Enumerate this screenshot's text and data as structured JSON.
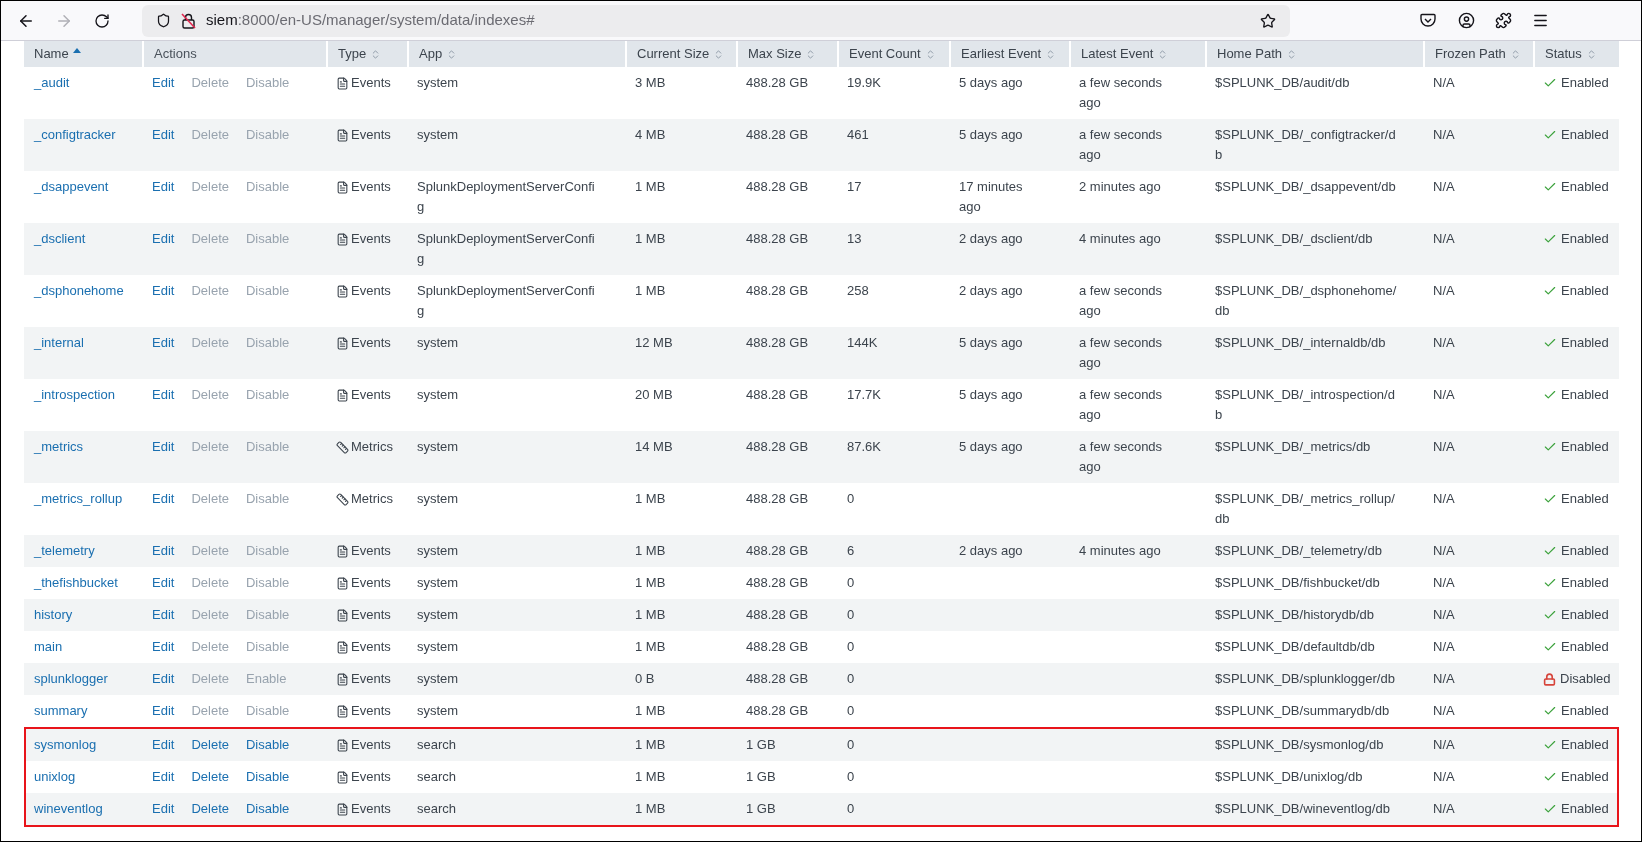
{
  "browser": {
    "url_host": "siem",
    "url_path": ":8000/en-US/manager/system/data/indexes#"
  },
  "table": {
    "columns": [
      {
        "label": "Name",
        "sortable": true,
        "selected": true
      },
      {
        "label": "Actions",
        "sortable": false,
        "selected": false
      },
      {
        "label": "Type",
        "sortable": true,
        "selected": false
      },
      {
        "label": "App",
        "sortable": true,
        "selected": false
      },
      {
        "label": "Current Size",
        "sortable": true,
        "selected": false
      },
      {
        "label": "Max Size",
        "sortable": true,
        "selected": false
      },
      {
        "label": "Event Count",
        "sortable": true,
        "selected": false
      },
      {
        "label": "Earliest Event",
        "sortable": true,
        "selected": false
      },
      {
        "label": "Latest Event",
        "sortable": true,
        "selected": false
      },
      {
        "label": "Home Path",
        "sortable": true,
        "selected": false
      },
      {
        "label": "Frozen Path",
        "sortable": true,
        "selected": false
      },
      {
        "label": "Status",
        "sortable": true,
        "selected": false
      }
    ],
    "rows": [
      {
        "name": "_audit",
        "actions": [
          {
            "label": "Edit",
            "disabled": false
          },
          {
            "label": "Delete",
            "disabled": true
          },
          {
            "label": "Disable",
            "disabled": true
          }
        ],
        "type": {
          "kind": "events",
          "label": "Events"
        },
        "app": "system",
        "current_size": "3 MB",
        "max_size": "488.28 GB",
        "event_count": "19.9K",
        "earliest_event": "5 days ago",
        "latest_event": "a few seconds ago",
        "home_path": "$SPLUNK_DB/audit/db",
        "frozen_path": "N/A",
        "status": {
          "kind": "enabled",
          "label": "Enabled"
        },
        "highlighted": false
      },
      {
        "name": "_configtracker",
        "actions": [
          {
            "label": "Edit",
            "disabled": false
          },
          {
            "label": "Delete",
            "disabled": true
          },
          {
            "label": "Disable",
            "disabled": true
          }
        ],
        "type": {
          "kind": "events",
          "label": "Events"
        },
        "app": "system",
        "current_size": "4 MB",
        "max_size": "488.28 GB",
        "event_count": "461",
        "earliest_event": "5 days ago",
        "latest_event": "a few seconds ago",
        "home_path": "$SPLUNK_DB/_configtracker/db",
        "frozen_path": "N/A",
        "status": {
          "kind": "enabled",
          "label": "Enabled"
        },
        "highlighted": false
      },
      {
        "name": "_dsappevent",
        "actions": [
          {
            "label": "Edit",
            "disabled": false
          },
          {
            "label": "Delete",
            "disabled": true
          },
          {
            "label": "Disable",
            "disabled": true
          }
        ],
        "type": {
          "kind": "events",
          "label": "Events"
        },
        "app": "SplunkDeploymentServerConfig",
        "current_size": "1 MB",
        "max_size": "488.28 GB",
        "event_count": "17",
        "earliest_event": "17 minutes ago",
        "latest_event": "2 minutes ago",
        "home_path": "$SPLUNK_DB/_dsappevent/db",
        "frozen_path": "N/A",
        "status": {
          "kind": "enabled",
          "label": "Enabled"
        },
        "highlighted": false
      },
      {
        "name": "_dsclient",
        "actions": [
          {
            "label": "Edit",
            "disabled": false
          },
          {
            "label": "Delete",
            "disabled": true
          },
          {
            "label": "Disable",
            "disabled": true
          }
        ],
        "type": {
          "kind": "events",
          "label": "Events"
        },
        "app": "SplunkDeploymentServerConfig",
        "current_size": "1 MB",
        "max_size": "488.28 GB",
        "event_count": "13",
        "earliest_event": "2 days ago",
        "latest_event": "4 minutes ago",
        "home_path": "$SPLUNK_DB/_dsclient/db",
        "frozen_path": "N/A",
        "status": {
          "kind": "enabled",
          "label": "Enabled"
        },
        "highlighted": false
      },
      {
        "name": "_dsphonehome",
        "actions": [
          {
            "label": "Edit",
            "disabled": false
          },
          {
            "label": "Delete",
            "disabled": true
          },
          {
            "label": "Disable",
            "disabled": true
          }
        ],
        "type": {
          "kind": "events",
          "label": "Events"
        },
        "app": "SplunkDeploymentServerConfig",
        "current_size": "1 MB",
        "max_size": "488.28 GB",
        "event_count": "258",
        "earliest_event": "2 days ago",
        "latest_event": "a few seconds ago",
        "home_path": "$SPLUNK_DB/_dsphonehome/db",
        "frozen_path": "N/A",
        "status": {
          "kind": "enabled",
          "label": "Enabled"
        },
        "highlighted": false
      },
      {
        "name": "_internal",
        "actions": [
          {
            "label": "Edit",
            "disabled": false
          },
          {
            "label": "Delete",
            "disabled": true
          },
          {
            "label": "Disable",
            "disabled": true
          }
        ],
        "type": {
          "kind": "events",
          "label": "Events"
        },
        "app": "system",
        "current_size": "12 MB",
        "max_size": "488.28 GB",
        "event_count": "144K",
        "earliest_event": "5 days ago",
        "latest_event": "a few seconds ago",
        "home_path": "$SPLUNK_DB/_internaldb/db",
        "frozen_path": "N/A",
        "status": {
          "kind": "enabled",
          "label": "Enabled"
        },
        "highlighted": false
      },
      {
        "name": "_introspection",
        "actions": [
          {
            "label": "Edit",
            "disabled": false
          },
          {
            "label": "Delete",
            "disabled": true
          },
          {
            "label": "Disable",
            "disabled": true
          }
        ],
        "type": {
          "kind": "events",
          "label": "Events"
        },
        "app": "system",
        "current_size": "20 MB",
        "max_size": "488.28 GB",
        "event_count": "17.7K",
        "earliest_event": "5 days ago",
        "latest_event": "a few seconds ago",
        "home_path": "$SPLUNK_DB/_introspection/db",
        "frozen_path": "N/A",
        "status": {
          "kind": "enabled",
          "label": "Enabled"
        },
        "highlighted": false
      },
      {
        "name": "_metrics",
        "actions": [
          {
            "label": "Edit",
            "disabled": false
          },
          {
            "label": "Delete",
            "disabled": true
          },
          {
            "label": "Disable",
            "disabled": true
          }
        ],
        "type": {
          "kind": "metrics",
          "label": "Metrics"
        },
        "app": "system",
        "current_size": "14 MB",
        "max_size": "488.28 GB",
        "event_count": "87.6K",
        "earliest_event": "5 days ago",
        "latest_event": "a few seconds ago",
        "home_path": "$SPLUNK_DB/_metrics/db",
        "frozen_path": "N/A",
        "status": {
          "kind": "enabled",
          "label": "Enabled"
        },
        "highlighted": false
      },
      {
        "name": "_metrics_rollup",
        "actions": [
          {
            "label": "Edit",
            "disabled": false
          },
          {
            "label": "Delete",
            "disabled": true
          },
          {
            "label": "Disable",
            "disabled": true
          }
        ],
        "type": {
          "kind": "metrics",
          "label": "Metrics"
        },
        "app": "system",
        "current_size": "1 MB",
        "max_size": "488.28 GB",
        "event_count": "0",
        "home_path": "$SPLUNK_DB/_metrics_rollup/db",
        "frozen_path": "N/A",
        "status": {
          "kind": "enabled",
          "label": "Enabled"
        },
        "highlighted": false
      },
      {
        "name": "_telemetry",
        "actions": [
          {
            "label": "Edit",
            "disabled": false
          },
          {
            "label": "Delete",
            "disabled": true
          },
          {
            "label": "Disable",
            "disabled": true
          }
        ],
        "type": {
          "kind": "events",
          "label": "Events"
        },
        "app": "system",
        "current_size": "1 MB",
        "max_size": "488.28 GB",
        "event_count": "6",
        "earliest_event": "2 days ago",
        "latest_event": "4 minutes ago",
        "home_path": "$SPLUNK_DB/_telemetry/db",
        "frozen_path": "N/A",
        "status": {
          "kind": "enabled",
          "label": "Enabled"
        },
        "highlighted": false
      },
      {
        "name": "_thefishbucket",
        "actions": [
          {
            "label": "Edit",
            "disabled": false
          },
          {
            "label": "Delete",
            "disabled": true
          },
          {
            "label": "Disable",
            "disabled": true
          }
        ],
        "type": {
          "kind": "events",
          "label": "Events"
        },
        "app": "system",
        "current_size": "1 MB",
        "max_size": "488.28 GB",
        "event_count": "0",
        "home_path": "$SPLUNK_DB/fishbucket/db",
        "frozen_path": "N/A",
        "status": {
          "kind": "enabled",
          "label": "Enabled"
        },
        "highlighted": false
      },
      {
        "name": "history",
        "actions": [
          {
            "label": "Edit",
            "disabled": false
          },
          {
            "label": "Delete",
            "disabled": true
          },
          {
            "label": "Disable",
            "disabled": true
          }
        ],
        "type": {
          "kind": "events",
          "label": "Events"
        },
        "app": "system",
        "current_size": "1 MB",
        "max_size": "488.28 GB",
        "event_count": "0",
        "home_path": "$SPLUNK_DB/historydb/db",
        "frozen_path": "N/A",
        "status": {
          "kind": "enabled",
          "label": "Enabled"
        },
        "highlighted": false
      },
      {
        "name": "main",
        "actions": [
          {
            "label": "Edit",
            "disabled": false
          },
          {
            "label": "Delete",
            "disabled": true
          },
          {
            "label": "Disable",
            "disabled": true
          }
        ],
        "type": {
          "kind": "events",
          "label": "Events"
        },
        "app": "system",
        "current_size": "1 MB",
        "max_size": "488.28 GB",
        "event_count": "0",
        "home_path": "$SPLUNK_DB/defaultdb/db",
        "frozen_path": "N/A",
        "status": {
          "kind": "enabled",
          "label": "Enabled"
        },
        "highlighted": false
      },
      {
        "name": "splunklogger",
        "actions": [
          {
            "label": "Edit",
            "disabled": false
          },
          {
            "label": "Delete",
            "disabled": true
          },
          {
            "label": "Enable",
            "disabled": true
          }
        ],
        "type": {
          "kind": "events",
          "label": "Events"
        },
        "app": "system",
        "current_size": "0 B",
        "max_size": "488.28 GB",
        "event_count": "0",
        "home_path": "$SPLUNK_DB/splunklogger/db",
        "frozen_path": "N/A",
        "status": {
          "kind": "disabled",
          "label": "Disabled"
        },
        "highlighted": false
      },
      {
        "name": "summary",
        "actions": [
          {
            "label": "Edit",
            "disabled": false
          },
          {
            "label": "Delete",
            "disabled": true
          },
          {
            "label": "Disable",
            "disabled": true
          }
        ],
        "type": {
          "kind": "events",
          "label": "Events"
        },
        "app": "system",
        "current_size": "1 MB",
        "max_size": "488.28 GB",
        "event_count": "0",
        "home_path": "$SPLUNK_DB/summarydb/db",
        "frozen_path": "N/A",
        "status": {
          "kind": "enabled",
          "label": "Enabled"
        },
        "highlighted": false
      },
      {
        "name": "sysmonlog",
        "actions": [
          {
            "label": "Edit",
            "disabled": false
          },
          {
            "label": "Delete",
            "disabled": false
          },
          {
            "label": "Disable",
            "disabled": false
          }
        ],
        "type": {
          "kind": "events",
          "label": "Events"
        },
        "app": "search",
        "current_size": "1 MB",
        "max_size": "1 GB",
        "event_count": "0",
        "home_path": "$SPLUNK_DB/sysmonlog/db",
        "frozen_path": "N/A",
        "status": {
          "kind": "enabled",
          "label": "Enabled"
        },
        "highlighted": true
      },
      {
        "name": "unixlog",
        "actions": [
          {
            "label": "Edit",
            "disabled": false
          },
          {
            "label": "Delete",
            "disabled": false
          },
          {
            "label": "Disable",
            "disabled": false
          }
        ],
        "type": {
          "kind": "events",
          "label": "Events"
        },
        "app": "search",
        "current_size": "1 MB",
        "max_size": "1 GB",
        "event_count": "0",
        "home_path": "$SPLUNK_DB/unixlog/db",
        "frozen_path": "N/A",
        "status": {
          "kind": "enabled",
          "label": "Enabled"
        },
        "highlighted": true
      },
      {
        "name": "wineventlog",
        "actions": [
          {
            "label": "Edit",
            "disabled": false
          },
          {
            "label": "Delete",
            "disabled": false
          },
          {
            "label": "Disable",
            "disabled": false
          }
        ],
        "type": {
          "kind": "events",
          "label": "Events"
        },
        "app": "search",
        "current_size": "1 MB",
        "max_size": "1 GB",
        "event_count": "0",
        "home_path": "$SPLUNK_DB/wineventlog/db",
        "frozen_path": "N/A",
        "status": {
          "kind": "enabled",
          "label": "Enabled"
        },
        "highlighted": true
      }
    ]
  }
}
